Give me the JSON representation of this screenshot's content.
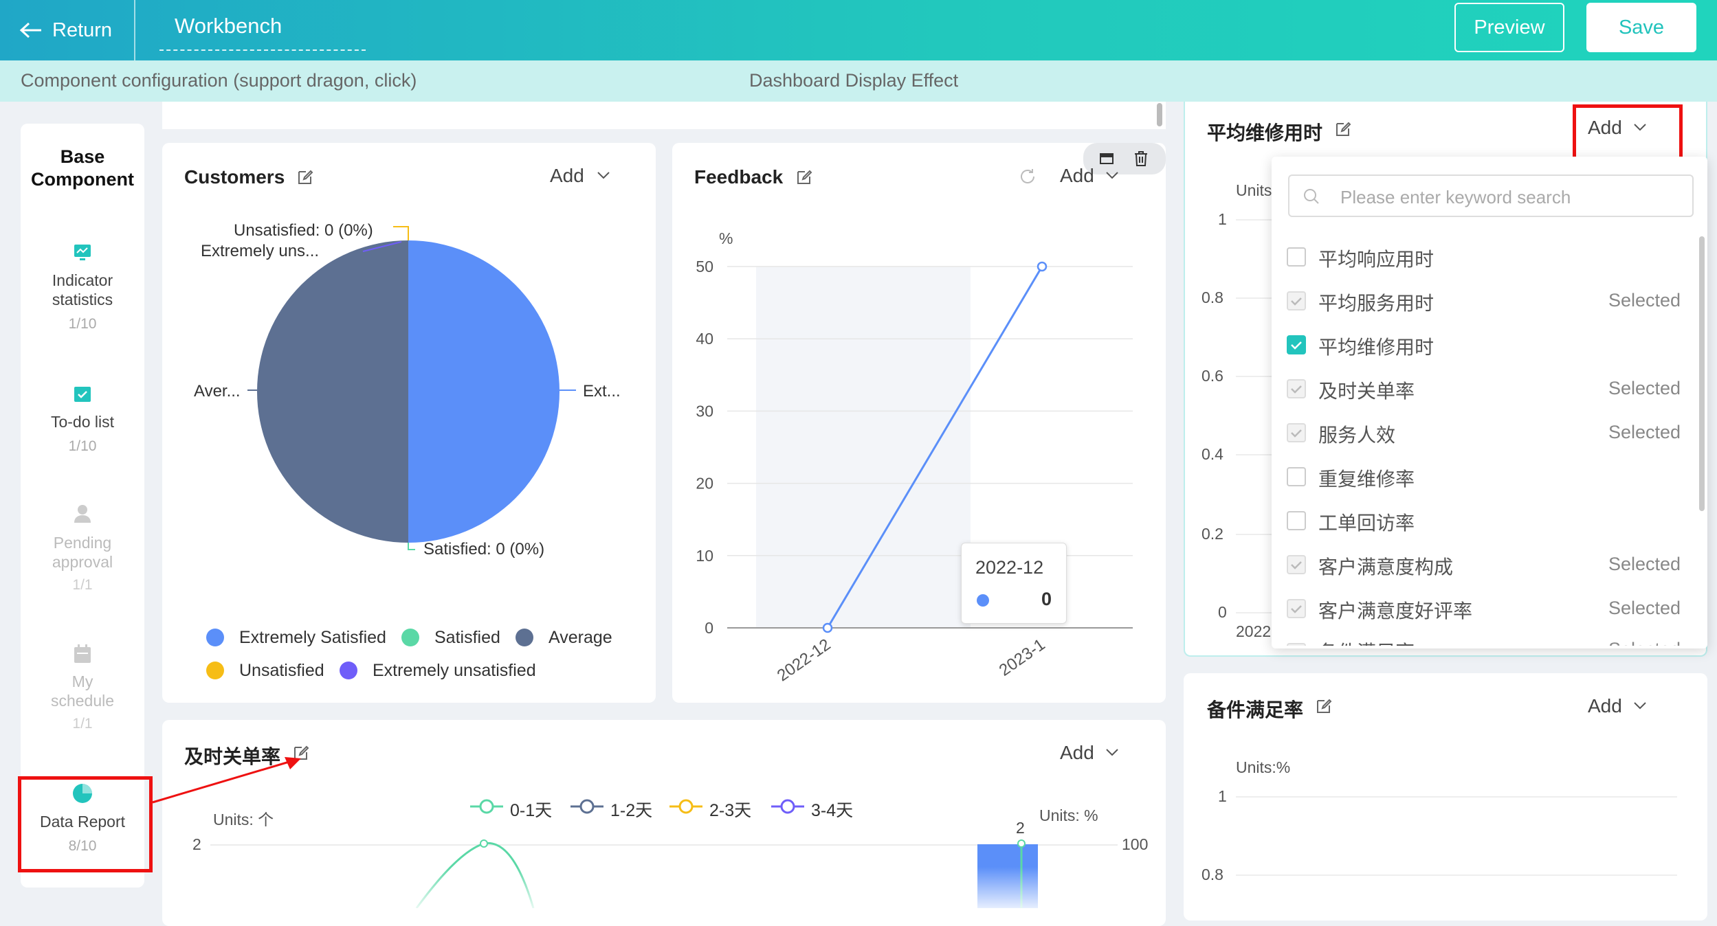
{
  "header": {
    "return_label": "Return",
    "title": "Workbench",
    "preview_label": "Preview",
    "save_label": "Save"
  },
  "subheader": {
    "left_text": "Component configuration (support dragon, click)",
    "center_text": "Dashboard Display Effect"
  },
  "sidebar": {
    "title": "Base Component",
    "items": [
      {
        "label": "Indicator statistics",
        "count": "1/10",
        "icon": "chart-icon",
        "enabled": true
      },
      {
        "label": "To-do list",
        "count": "1/10",
        "icon": "checkbox-icon",
        "enabled": true
      },
      {
        "label": "Pending approval",
        "count": "1/1",
        "icon": "user-icon",
        "enabled": false
      },
      {
        "label": "My schedule",
        "count": "1/1",
        "icon": "calendar-icon",
        "enabled": false
      },
      {
        "label": "Data Report",
        "count": "8/10",
        "icon": "pie-icon",
        "enabled": true
      }
    ]
  },
  "customers": {
    "title": "Customers",
    "add_label": "Add",
    "labels": {
      "unsatisfied": "Unsatisfied:  0 (0%)",
      "extremely_uns": "Extremely uns...",
      "average": "Aver...",
      "extremely": "Ext...",
      "satisfied": "Satisfied:  0 (0%)"
    },
    "legend": [
      "Extremely Satisfied",
      "Satisfied",
      "Average",
      "Unsatisfied",
      "Extremely unsatisfied"
    ]
  },
  "feedback": {
    "title": "Feedback",
    "add_label": "Add",
    "unit": "%",
    "yticks": [
      "50",
      "40",
      "30",
      "20",
      "10",
      "0"
    ],
    "xticks": [
      "2022-12",
      "2023-1"
    ],
    "tooltip": {
      "date": "2022-12",
      "value": "0"
    }
  },
  "jishi": {
    "title": "及时关单率",
    "add_label": "Add",
    "unit_left": "Units: 个",
    "unit_right": "Units: %",
    "left_tick": "2",
    "right_tick": "100",
    "bar_label": "2",
    "legend": [
      "0-1天",
      "1-2天",
      "2-3天",
      "3-4天"
    ]
  },
  "pingjun": {
    "title": "平均维修用时",
    "add_label": "Add",
    "unit": "Units:",
    "yticks": [
      "1",
      "0.8",
      "0.6",
      "0.4",
      "0.2",
      "0"
    ],
    "xtick": "2022"
  },
  "beijian": {
    "title": "备件满足率",
    "add_label": "Add",
    "unit": "Units:%",
    "yticks": [
      "1",
      "0.8"
    ]
  },
  "dropdown": {
    "search_placeholder": "Please enter keyword search",
    "selected_label": "Selected",
    "items": [
      {
        "label": "平均响应用时",
        "state": "unchecked"
      },
      {
        "label": "平均服务用时",
        "state": "selected"
      },
      {
        "label": "平均维修用时",
        "state": "checked"
      },
      {
        "label": "及时关单率",
        "state": "selected"
      },
      {
        "label": "服务人效",
        "state": "selected"
      },
      {
        "label": "重复维修率",
        "state": "unchecked"
      },
      {
        "label": "工单回访率",
        "state": "unchecked"
      },
      {
        "label": "客户满意度构成",
        "state": "selected"
      },
      {
        "label": "客户满意度好评率",
        "state": "selected"
      },
      {
        "label": "备件满足率",
        "state": "selected"
      }
    ]
  },
  "chart_data": [
    {
      "type": "pie",
      "title": "Customers",
      "categories": [
        "Extremely Satisfied",
        "Satisfied",
        "Average",
        "Unsatisfied",
        "Extremely unsatisfied"
      ],
      "values": [
        50,
        0,
        50,
        0,
        0
      ],
      "colors": [
        "#5b8ff9",
        "#5ad8a6",
        "#5d7092",
        "#f6bd16",
        "#6f5ef9"
      ]
    },
    {
      "type": "line",
      "title": "Feedback",
      "ylabel": "%",
      "x": [
        "2022-12",
        "2023-1"
      ],
      "series": [
        {
          "values": [
            0,
            50
          ]
        }
      ],
      "ylim": [
        0,
        50
      ]
    }
  ],
  "colors": {
    "accent": "#22c4bd",
    "annotation": "#e11111"
  }
}
